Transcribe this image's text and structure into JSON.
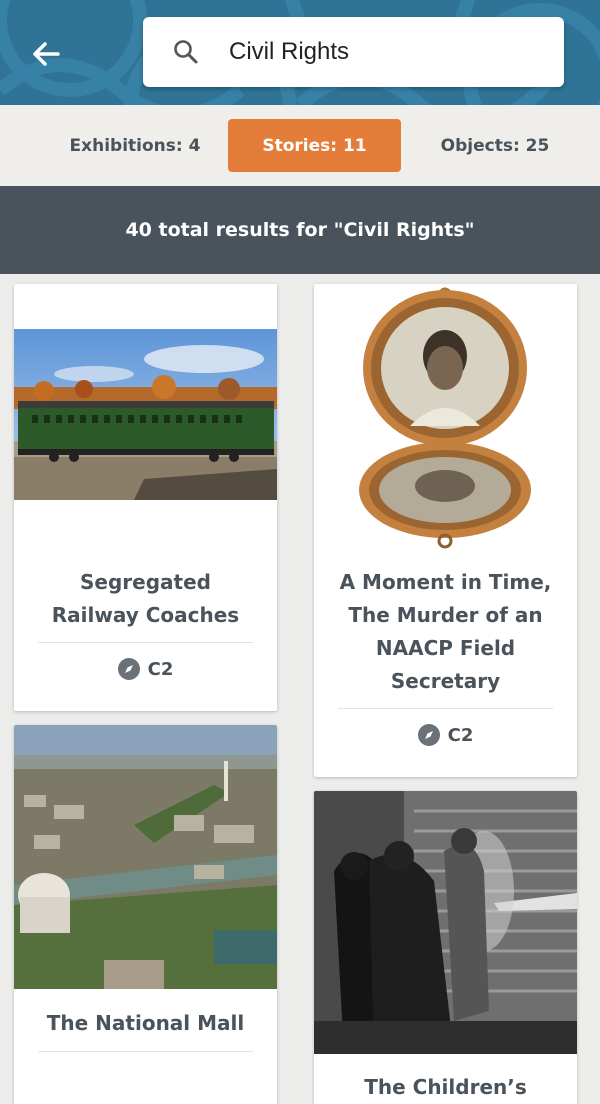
{
  "header": {
    "back_icon": "arrow-left-icon",
    "search": {
      "value": "Civil Rights",
      "icon": "search-icon"
    },
    "background_color": "#2f7396"
  },
  "tabs": [
    {
      "label": "Exhibitions: 4",
      "active": false
    },
    {
      "label": "Stories: 11",
      "active": true
    },
    {
      "label": "Objects: 25",
      "active": false
    }
  ],
  "accent_color": "#e57d3a",
  "results_summary": "40 total results for \"Civil Rights\"",
  "cards": [
    {
      "title": "Segregated Railway Coaches",
      "location": "C2",
      "image": "green railway coach photo"
    },
    {
      "title": "A Moment in Time, The Murder of an NAACP Field Secretary",
      "location": "C2",
      "image": "open locket with portrait photos"
    },
    {
      "title": "The National Mall",
      "image": "aerial photo of Washington D.C."
    },
    {
      "title": "The Children’s",
      "image": "black and white fire hose protest photo"
    }
  ]
}
